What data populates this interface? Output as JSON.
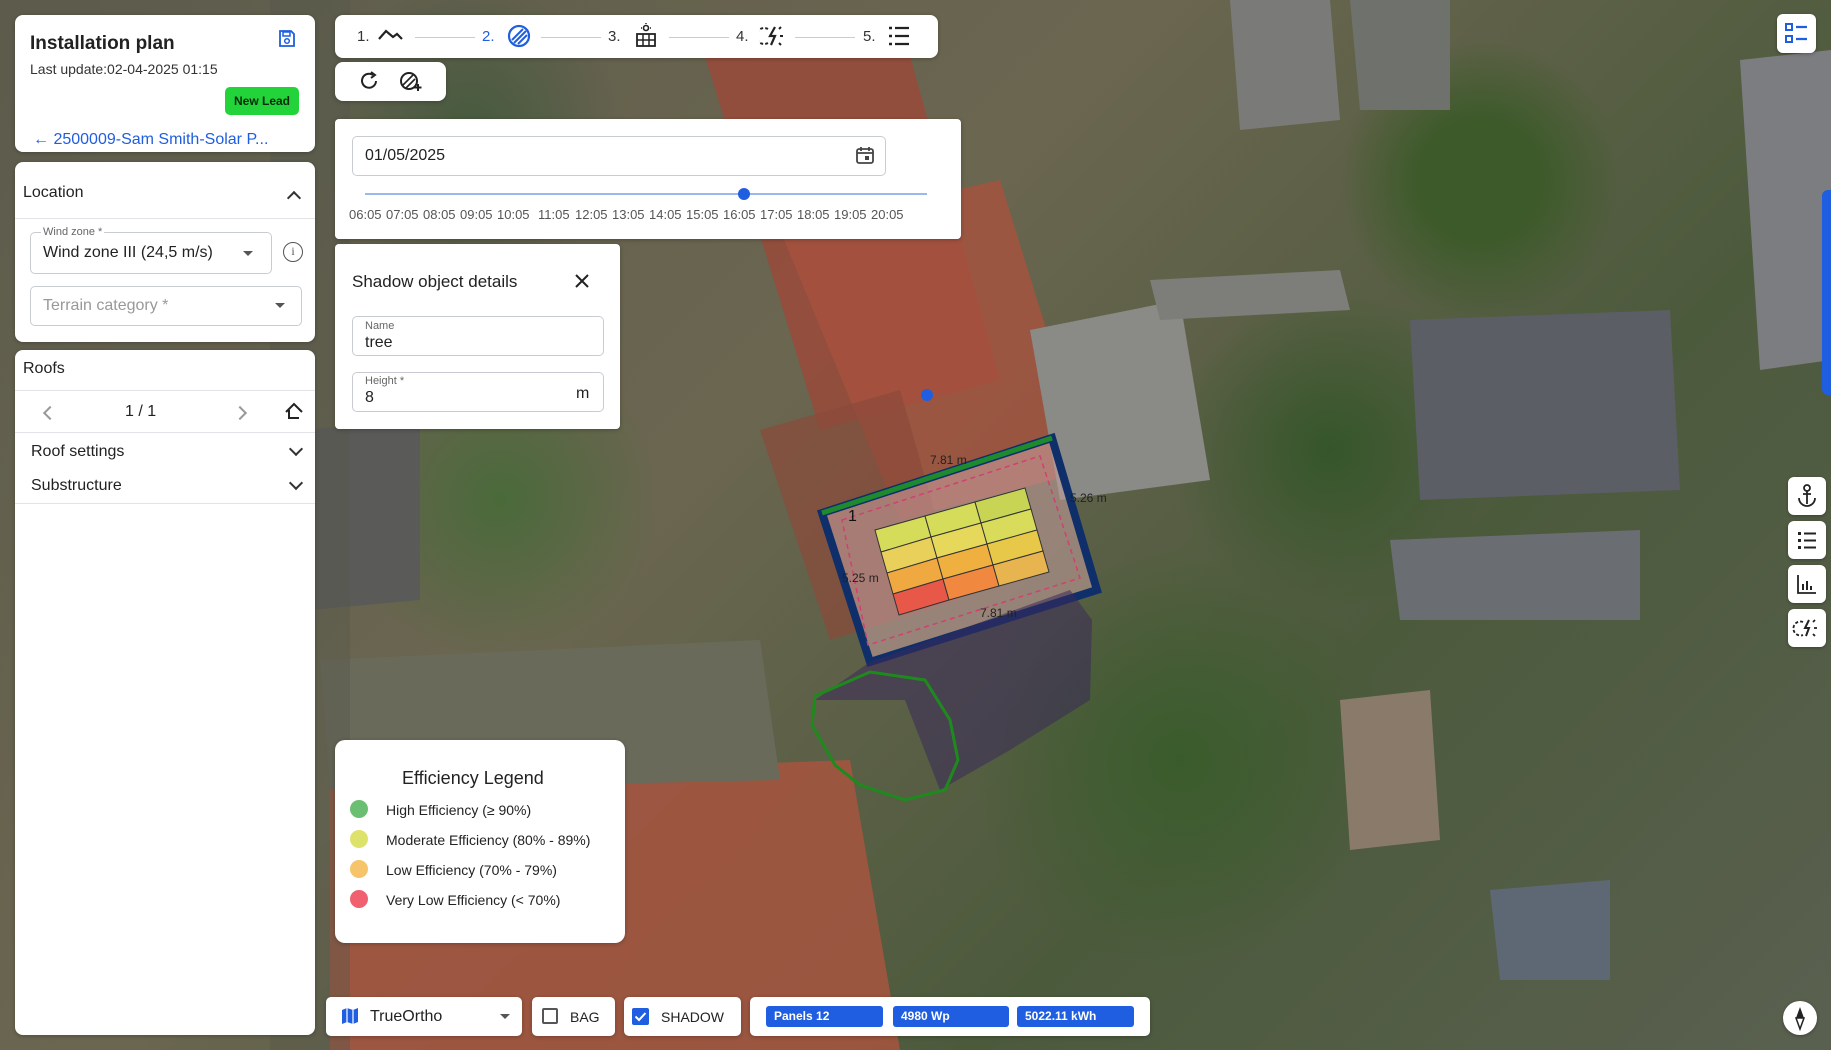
{
  "header": {
    "title": "Installation plan",
    "last_update": "Last update:02-04-2025 01:15",
    "status_badge": "New Lead",
    "back_link": "2500009-Sam Smith-Solar P..."
  },
  "location": {
    "title": "Location",
    "wind_zone": {
      "label": "Wind zone *",
      "value": "Wind zone III (24,5 m/s)"
    },
    "terrain_category": {
      "placeholder": "Terrain category *"
    }
  },
  "roofs": {
    "title": "Roofs",
    "pager": "1 / 1",
    "roof_settings": "Roof settings",
    "substructure": "Substructure"
  },
  "steps": [
    {
      "num": "1.",
      "icon": "roof-icon"
    },
    {
      "num": "2.",
      "icon": "shadow-icon",
      "active": true
    },
    {
      "num": "3.",
      "icon": "solar-panel-icon"
    },
    {
      "num": "4.",
      "icon": "energy-icon"
    },
    {
      "num": "5.",
      "icon": "list-icon"
    }
  ],
  "date_picker": {
    "value": "01/05/2025",
    "times": [
      "06:05",
      "07:05",
      "08:05",
      "09:05",
      "10:05",
      "11:05",
      "12:05",
      "13:05",
      "14:05",
      "15:05",
      "16:05",
      "17:05",
      "18:05",
      "19:05",
      "20:05"
    ],
    "selected_time": "16:05"
  },
  "shadow_details": {
    "title": "Shadow object details",
    "name_label": "Name",
    "name_value": "tree",
    "height_label": "Height *",
    "height_value": "8",
    "height_unit": "m"
  },
  "legend": {
    "title": "Efficiency Legend",
    "items": [
      {
        "label": "High Efficiency (≥ 90%)",
        "color": "#6bbf73"
      },
      {
        "label": "Moderate Efficiency (80% - 89%)",
        "color": "#dde36a"
      },
      {
        "label": "Low Efficiency (70% - 79%)",
        "color": "#f6c46a"
      },
      {
        "label": "Very Low Efficiency (< 70%)",
        "color": "#f0606e"
      }
    ]
  },
  "map": {
    "roof_number": "1",
    "dimensions": [
      "7.81 m",
      "5.26 m",
      "5.25 m",
      "7.81 m"
    ]
  },
  "bottom_bar": {
    "layer": "TrueOrtho",
    "bag_label": "BAG",
    "bag_checked": false,
    "shadow_label": "SHADOW",
    "shadow_checked": true,
    "panels": "Panels 12",
    "power": "4980 Wp",
    "energy": "5022.11 kWh"
  },
  "colors": {
    "accent": "#1f5ee0",
    "badge_green": "#22d33a",
    "roof_outline": "#0f2f6b",
    "ridge": "#1e8a2e",
    "tree_outline": "#1e8a1e"
  }
}
